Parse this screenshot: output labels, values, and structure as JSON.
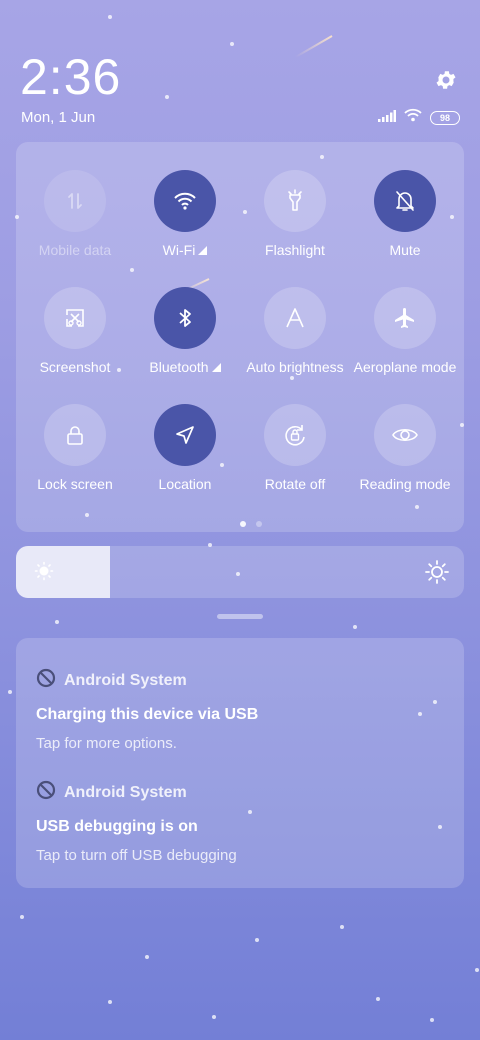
{
  "status": {
    "time": "2:36",
    "date": "Mon, 1 Jun",
    "battery": "98"
  },
  "quick_settings": {
    "tiles": [
      {
        "label": "Mobile data",
        "icon": "mobile-data-icon",
        "state": "disabled"
      },
      {
        "label": "Wi-Fi",
        "icon": "wifi-icon",
        "state": "on"
      },
      {
        "label": "Flashlight",
        "icon": "flashlight-icon",
        "state": "off"
      },
      {
        "label": "Mute",
        "icon": "mute-bell-icon",
        "state": "on"
      },
      {
        "label": "Screenshot",
        "icon": "screenshot-icon",
        "state": "off"
      },
      {
        "label": "Bluetooth",
        "icon": "bluetooth-icon",
        "state": "on"
      },
      {
        "label": "Auto brightness",
        "icon": "auto-brightness-icon",
        "state": "off"
      },
      {
        "label": "Aeroplane mode",
        "icon": "airplane-icon",
        "state": "off"
      },
      {
        "label": "Lock screen",
        "icon": "lock-icon",
        "state": "off"
      },
      {
        "label": "Location",
        "icon": "location-arrow-icon",
        "state": "on"
      },
      {
        "label": "Rotate off",
        "icon": "rotate-lock-icon",
        "state": "off"
      },
      {
        "label": "Reading mode",
        "icon": "eye-icon",
        "state": "off"
      }
    ],
    "page": 1,
    "page_count": 2
  },
  "brightness": {
    "level": 0.21
  },
  "notifications": [
    {
      "app": "Android System",
      "title": "Charging this device via USB",
      "text": "Tap for more options."
    },
    {
      "app": "Android System",
      "title": "USB debugging is on",
      "text": "Tap to turn off USB debugging"
    }
  ],
  "colors": {
    "active_tile": "#4a55a8",
    "background_top": "#a7a5e6",
    "background_bottom": "#737fd6"
  }
}
